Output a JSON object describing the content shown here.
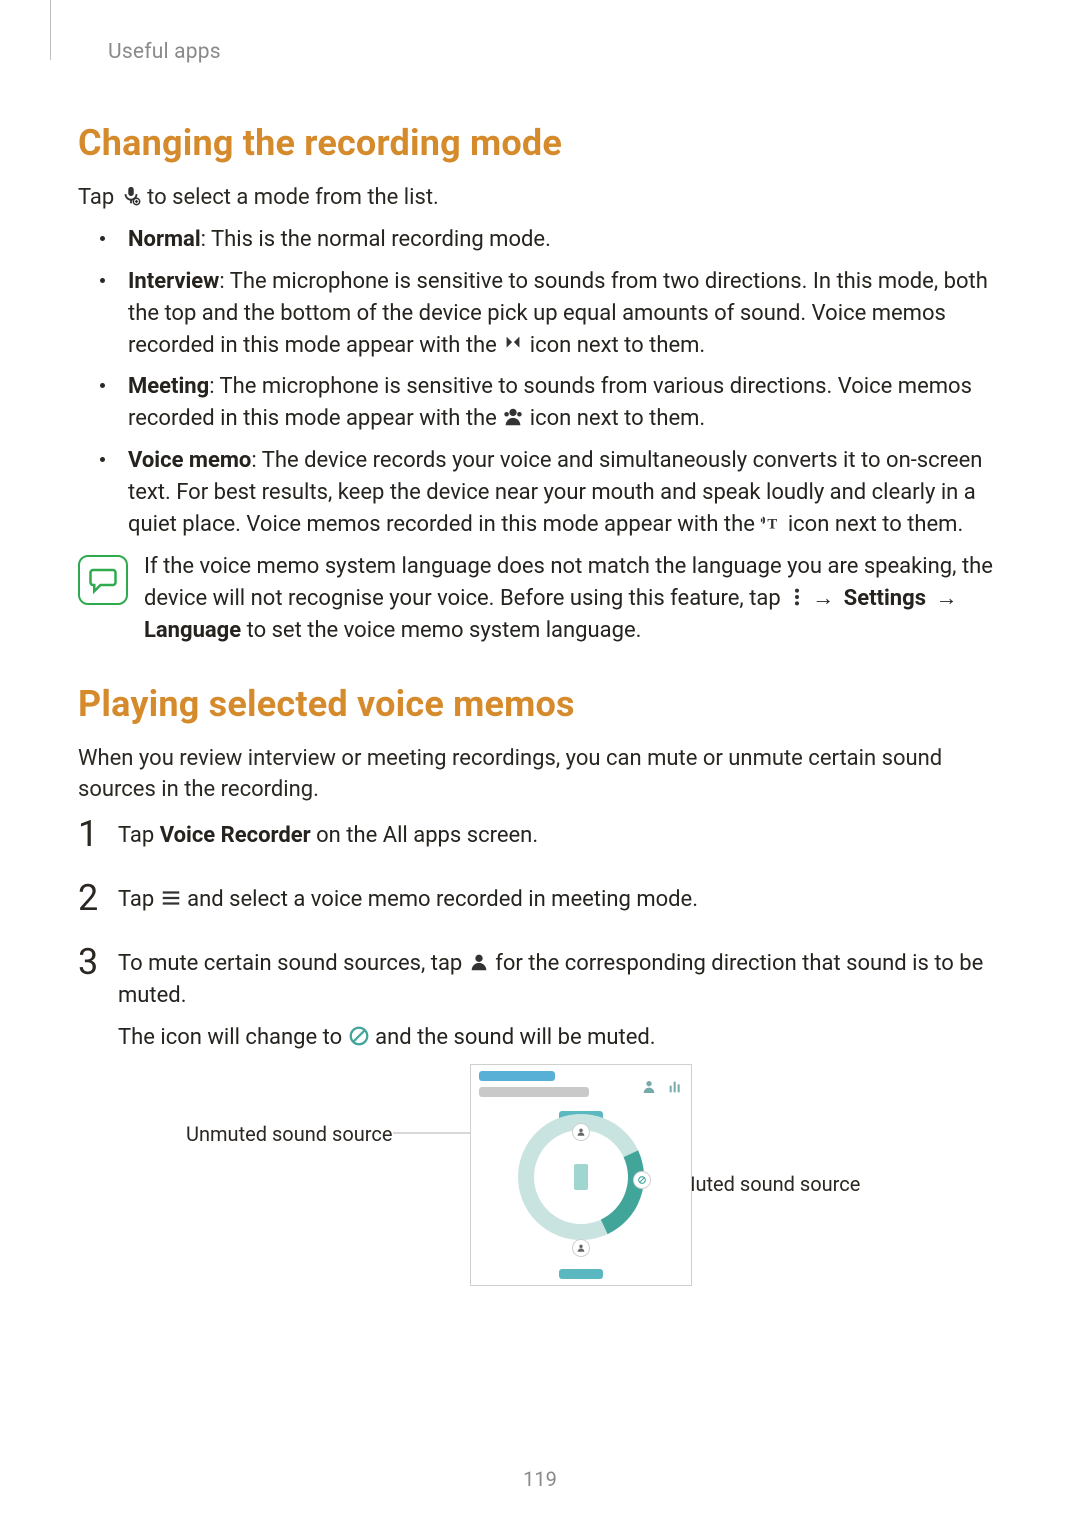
{
  "running_head": "Useful apps",
  "page_number": "119",
  "section1": {
    "title": "Changing the recording mode",
    "intro_pre": "Tap ",
    "intro_post": " to select a mode from the list.",
    "items": {
      "normal": {
        "label": "Normal",
        "text": ": This is the normal recording mode."
      },
      "interview": {
        "label": "Interview",
        "text_a": ": The microphone is sensitive to sounds from two directions. In this mode, both the top and the bottom of the device pick up equal amounts of sound. Voice memos recorded in this mode appear with the ",
        "text_b": " icon next to them."
      },
      "meeting": {
        "label": "Meeting",
        "text_a": ": The microphone is sensitive to sounds from various directions. Voice memos recorded in this mode appear with the ",
        "text_b": " icon next to them."
      },
      "voicememo": {
        "label": "Voice memo",
        "text_a": ": The device records your voice and simultaneously converts it to on-screen text. For best results, keep the device near your mouth and speak loudly and clearly in a quiet place. Voice memos recorded in this mode appear with the ",
        "text_b": " icon next to them."
      }
    },
    "note": {
      "text_a": "If the voice memo system language does not match the language you are speaking, the device will not recognise your voice. Before using this feature, tap ",
      "settings": "Settings",
      "language": "Language",
      "text_b": " to set the voice memo system language."
    }
  },
  "section2": {
    "title": "Playing selected voice memos",
    "intro": "When you review interview or meeting recordings, you can mute or unmute certain sound sources in the recording.",
    "step1_a": "Tap ",
    "step1_bold": "Voice Recorder",
    "step1_b": " on the All apps screen.",
    "step2_a": "Tap ",
    "step2_b": " and select a voice memo recorded in meeting mode.",
    "step3_a": "To mute certain sound sources, tap ",
    "step3_b": " for the corresponding direction that sound is to be muted.",
    "step3_c_a": "The icon will change to ",
    "step3_c_b": " and the sound will be muted.",
    "callouts": {
      "unmuted": "Unmuted sound source",
      "muted": "Muted sound source"
    }
  },
  "icons": {
    "mode_select": "mic-settings-icon",
    "interview": "interview-mics-icon",
    "meeting": "person-group-icon",
    "voice_memo": "voice-to-text-icon",
    "more_options": "more-options-vertical-icon",
    "note": "speech-bubble-icon",
    "list": "list-menu-icon",
    "person": "person-icon",
    "muted": "muted-circle-icon",
    "equalizer": "equalizer-icon"
  },
  "arrow": "→"
}
